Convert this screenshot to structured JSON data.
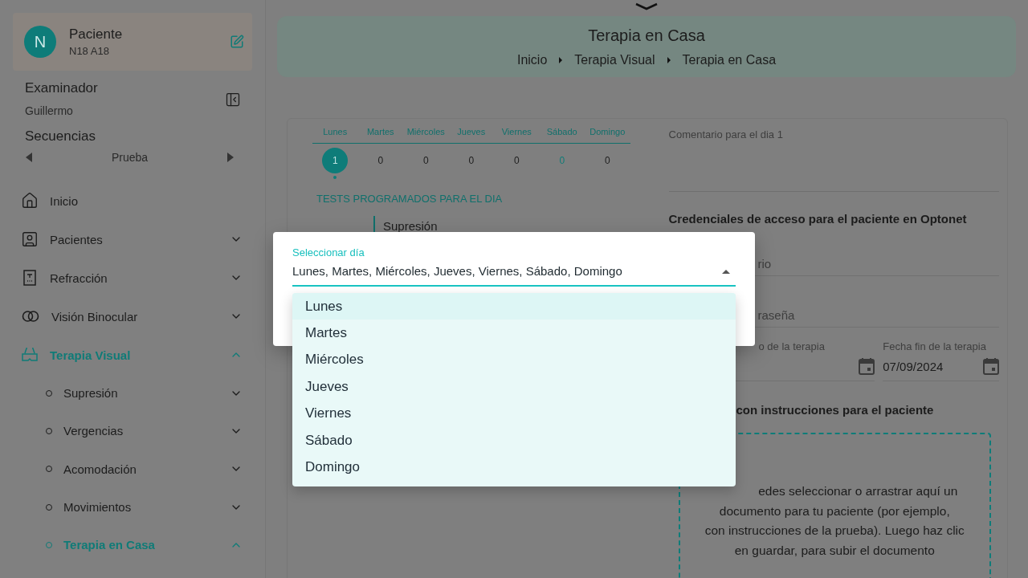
{
  "sidebar": {
    "patient": {
      "avatar": "N",
      "title": "Paciente",
      "subtitle": "N18 A18"
    },
    "examiner": {
      "label": "Examinador",
      "name": "Guillermo"
    },
    "sequences": {
      "label": "Secuencias",
      "value": "Prueba"
    },
    "nav": [
      {
        "label": "Inicio",
        "kind": "link",
        "selected": false
      },
      {
        "label": "Pacientes",
        "kind": "group",
        "selected": false,
        "expanded": false
      },
      {
        "label": "Refracción",
        "kind": "group",
        "selected": false,
        "expanded": false
      },
      {
        "label": "Visión Binocular",
        "kind": "group",
        "selected": false,
        "expanded": false
      },
      {
        "label": "Terapia Visual",
        "kind": "group",
        "selected": true,
        "expanded": true,
        "children": [
          {
            "label": "Supresión",
            "selected": false,
            "expanded": false
          },
          {
            "label": "Vergencias",
            "selected": false,
            "expanded": false
          },
          {
            "label": "Acomodación",
            "selected": false,
            "expanded": false
          },
          {
            "label": "Movimientos",
            "selected": false,
            "expanded": false
          },
          {
            "label": "Terapia en Casa",
            "selected": true,
            "expanded": true
          }
        ]
      }
    ]
  },
  "header": {
    "title": "Terapia en Casa",
    "breadcrumbs": [
      "Inicio",
      "Terapia Visual",
      "Terapia en Casa"
    ]
  },
  "week": {
    "days": [
      {
        "label": "Lunes",
        "count": "1",
        "selected": true,
        "today": false
      },
      {
        "label": "Martes",
        "count": "0",
        "selected": false,
        "today": false
      },
      {
        "label": "Miércoles",
        "count": "0",
        "selected": false,
        "today": false
      },
      {
        "label": "Jueves",
        "count": "0",
        "selected": false,
        "today": false
      },
      {
        "label": "Viernes",
        "count": "0",
        "selected": false,
        "today": false
      },
      {
        "label": "Sábado",
        "count": "0",
        "selected": false,
        "today": true
      },
      {
        "label": "Domingo",
        "count": "0",
        "selected": false,
        "today": false
      }
    ]
  },
  "tests_heading": "TESTS PROGRAMADOS PARA EL DIA",
  "tests": [
    "Supresión"
  ],
  "comment": {
    "placeholder": "Comentario para el dia 1"
  },
  "credentials_heading": "Credenciales de acceso para el paciente en Optonet",
  "username": {
    "placeholder": "rio"
  },
  "password": {
    "placeholder": "raseña"
  },
  "start_date": {
    "label": "o de la terapia"
  },
  "end_date": {
    "label": "Fecha fin de la terapia",
    "value": "07/09/2024"
  },
  "document_heading": "con instrucciones para el paciente",
  "drop_zone": {
    "lines": [
      "edes seleccionar o arrastrar aquí un",
      "documento para tu paciente (por ejemplo,",
      "con instrucciones de la prueba). Luego haz clic",
      "en guardar, para subir el documento"
    ]
  },
  "dialog": {
    "select": {
      "label": "Seleccionar día",
      "value": "Lunes, Martes, Miércoles, Jueves, Viernes, Sábado, Domingo",
      "expanded": true
    },
    "options": [
      {
        "label": "Lunes",
        "focused": true
      },
      {
        "label": "Martes",
        "focused": false
      },
      {
        "label": "Miércoles",
        "focused": false
      },
      {
        "label": "Jueves",
        "focused": false
      },
      {
        "label": "Viernes",
        "focused": false
      },
      {
        "label": "Sábado",
        "focused": false
      },
      {
        "label": "Domingo",
        "focused": false
      }
    ]
  }
}
